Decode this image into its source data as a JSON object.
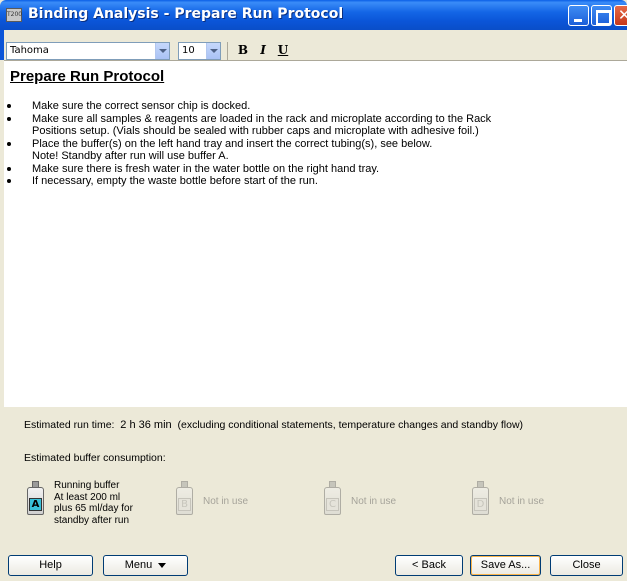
{
  "window": {
    "title": "Binding Analysis - Prepare Run Protocol",
    "icon_text": "T200"
  },
  "toolbar": {
    "font": "Tahoma",
    "size": "10",
    "bold": "B",
    "italic": "I",
    "underline": "U"
  },
  "document": {
    "heading": "Prepare Run Protocol",
    "bullets": [
      "Make sure the correct sensor chip is docked.",
      "Make sure all samples & reagents are loaded in the rack and microplate according to the Rack",
      "Positions setup. (Vials should be sealed with rubber caps and microplate with adhesive foil.)",
      "Place the buffer(s) on the left hand tray and insert the correct tubing(s), see below.",
      "Note! Standby after run will use buffer A.",
      "Make sure there is fresh water in the water bottle on the right hand tray.",
      "If necessary, empty the waste bottle before start of the run."
    ]
  },
  "info": {
    "runtime_label": "Estimated run time:",
    "runtime_value": "2 h  36 min",
    "runtime_note": "(excluding conditional statements, temperature changes and standby flow)",
    "buffer_label": "Estimated buffer consumption:",
    "buffers": [
      {
        "letter": "A",
        "line1": "Running buffer",
        "line2": "At least 200 ml",
        "line3": "plus 65 ml/day for",
        "line4": "standby after run"
      },
      {
        "letter": "B",
        "text": "Not in use"
      },
      {
        "letter": "C",
        "text": "Not in use"
      },
      {
        "letter": "D",
        "text": "Not in use"
      }
    ]
  },
  "buttons": {
    "help": "Help",
    "menu": "Menu",
    "back": "< Back",
    "save_as": "Save As...",
    "close": "Close"
  }
}
